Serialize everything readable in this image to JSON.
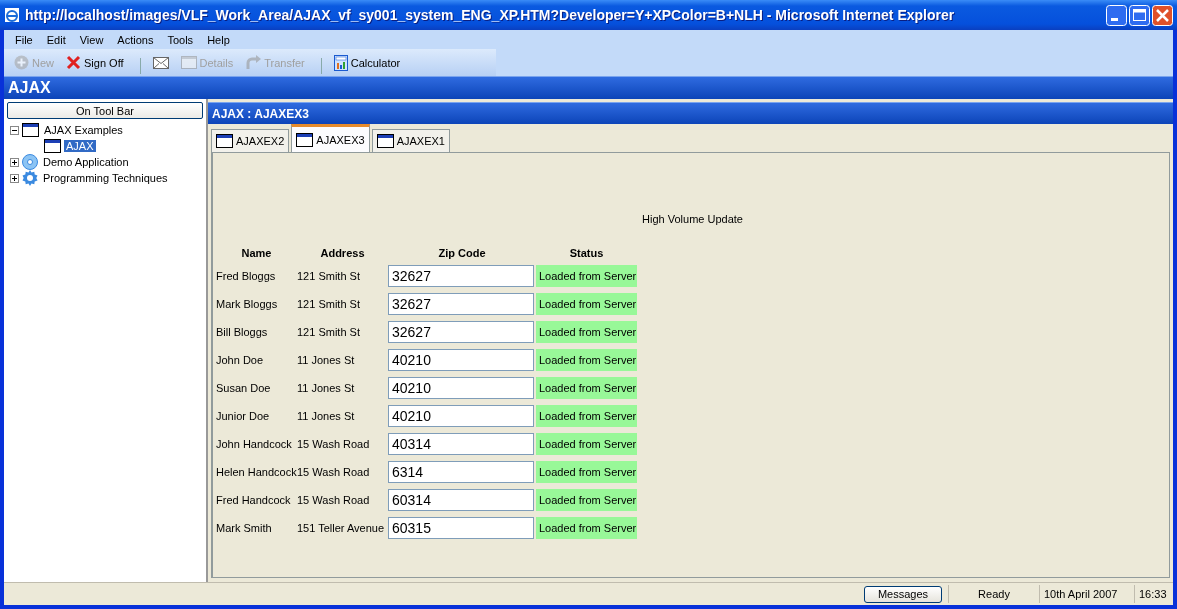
{
  "window": {
    "title": "http://localhost/images/VLF_Work_Area/AJAX_vf_sy001_system_ENG_XP.HTM?Developer=Y+XPColor=B+NLH - Microsoft Internet Explorer"
  },
  "menu": [
    "File",
    "Edit",
    "View",
    "Actions",
    "Tools",
    "Help"
  ],
  "toolbar": [
    {
      "kind": "new",
      "label": "New",
      "disabled": true
    },
    {
      "kind": "signoff",
      "label": "Sign Off",
      "disabled": false
    },
    {
      "kind": "separator"
    },
    {
      "kind": "mail",
      "disabled": false
    },
    {
      "kind": "details",
      "label": "Details",
      "disabled": true
    },
    {
      "kind": "transfer",
      "label": "Transfer",
      "disabled": true
    },
    {
      "kind": "separator"
    },
    {
      "kind": "calculator",
      "label": "Calculator",
      "disabled": false
    }
  ],
  "app_header": "AJAX",
  "sidebar": {
    "button": "On Tool Bar",
    "tree": [
      {
        "label": "AJAX Examples",
        "kind": "window",
        "expanded": true,
        "selected": false,
        "children": [
          {
            "label": "AJAX",
            "kind": "window",
            "selected": true
          }
        ]
      },
      {
        "label": "Demo Application",
        "kind": "disc",
        "expanded": false,
        "selected": false
      },
      {
        "label": "Programming Techniques",
        "kind": "gear",
        "expanded": false,
        "selected": false
      }
    ]
  },
  "panel": {
    "title": "AJAX : AJAXEX3",
    "tabs": [
      {
        "label": "AJAXEX2",
        "selected": false
      },
      {
        "label": "AJAXEX3",
        "selected": true
      },
      {
        "label": "AJAXEX1",
        "selected": false
      }
    ],
    "heading": "High Volume Update",
    "table": {
      "columns": [
        "Name",
        "Address",
        "Zip Code",
        "Status"
      ],
      "rows": [
        {
          "name": "Fred Bloggs",
          "address": "121 Smith St",
          "zip": "32627",
          "status": "Loaded from Server"
        },
        {
          "name": "Mark Bloggs",
          "address": "121 Smith St",
          "zip": "32627",
          "status": "Loaded from Server"
        },
        {
          "name": "Bill Bloggs",
          "address": "121 Smith St",
          "zip": "32627",
          "status": "Loaded from Server"
        },
        {
          "name": "John Doe",
          "address": "11 Jones St",
          "zip": "40210",
          "status": "Loaded from Server"
        },
        {
          "name": "Susan Doe",
          "address": "11 Jones St",
          "zip": "40210",
          "status": "Loaded from Server"
        },
        {
          "name": "Junior Doe",
          "address": "11 Jones St",
          "zip": "40210",
          "status": "Loaded from Server"
        },
        {
          "name": "John Handcock",
          "address": "15 Wash Road",
          "zip": "40314",
          "status": "Loaded from Server"
        },
        {
          "name": "Helen Handcock",
          "address": "15 Wash Road",
          "zip": "6314",
          "status": "Loaded from Server"
        },
        {
          "name": "Fred Handcock",
          "address": "15 Wash Road",
          "zip": "60314",
          "status": "Loaded from Server"
        },
        {
          "name": "Mark Smith",
          "address": "151 Teller Avenue",
          "zip": "60315",
          "status": "Loaded from Server"
        }
      ]
    }
  },
  "status_bar": {
    "button": "Messages",
    "state": "Ready",
    "date": "10th April 2007",
    "time": "16:33"
  }
}
